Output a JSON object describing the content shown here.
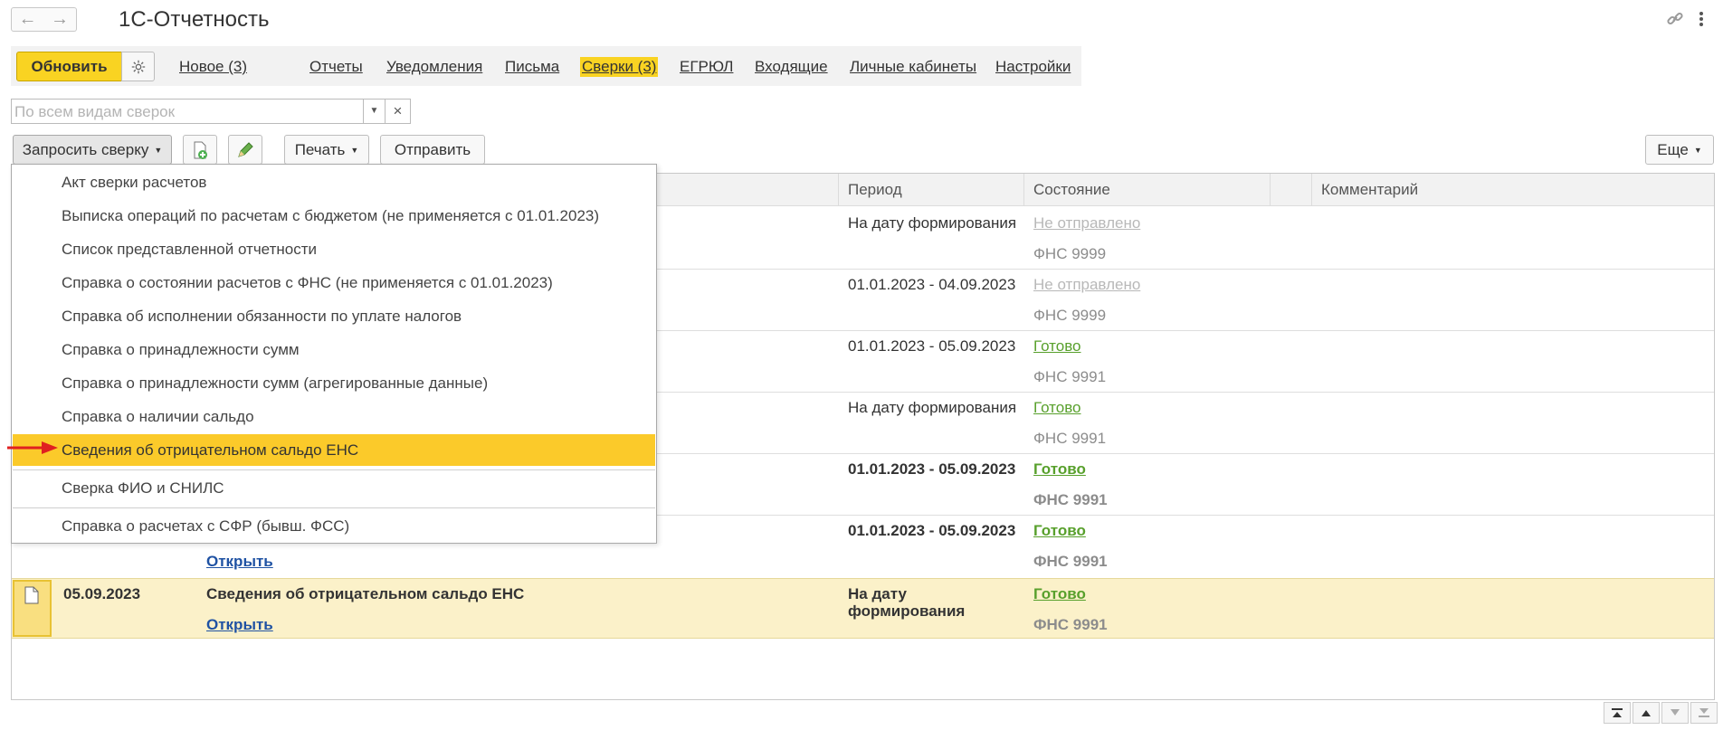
{
  "window": {
    "title": "1С-Отчетность"
  },
  "menu": {
    "refresh": "Обновить",
    "items": [
      "Новое (3)",
      "Отчеты",
      "Уведомления",
      "Письма",
      "Сверки (3)",
      "ЕГРЮЛ",
      "Входящие",
      "Личные кабинеты",
      "Настройки"
    ]
  },
  "search": {
    "placeholder": "По всем видам сверок"
  },
  "toolbar": {
    "request": "Запросить сверку",
    "print": "Печать",
    "send": "Отправить",
    "more": "Еще"
  },
  "columns": {
    "period": "Период",
    "state": "Состояние",
    "comment": "Комментарий"
  },
  "dropdown": {
    "items": [
      "Акт сверки расчетов",
      "Выписка операций по расчетам с бюджетом (не применяется с 01.01.2023)",
      "Список представленной отчетности",
      "Справка о состоянии расчетов с ФНС (не применяется с 01.01.2023)",
      "Справка об исполнении обязанности по уплате налогов",
      "Справка о принадлежности сумм",
      "Справка о принадлежности сумм (агрегированные данные)",
      "Справка о наличии сальдо",
      "Сведения об отрицательном сальдо ЕНС",
      "Сверка ФИО и СНИЛС",
      "Справка о расчетах с СФР (бывш. ФСС)"
    ],
    "highlighted_index": 8
  },
  "rows": [
    {
      "period": "На дату формирования",
      "status": "Не отправлено",
      "authority": "ФНС 9999"
    },
    {
      "period": "01.01.2023 - 04.09.2023",
      "status": "Не отправлено",
      "authority": "ФНС 9999"
    },
    {
      "period": "01.01.2023 - 05.09.2023",
      "status": "Готово",
      "authority": "ФНС 9991"
    },
    {
      "period": "На дату формирования",
      "status": "Готово",
      "authority": "ФНС 9991"
    },
    {
      "period": "01.01.2023 - 05.09.2023",
      "status": "Готово",
      "authority": "ФНС 9991"
    },
    {
      "period": "01.01.2023 - 05.09.2023",
      "status": "Готово",
      "authority": "ФНС 9991",
      "link": "Открыть"
    }
  ],
  "selected_row": {
    "date": "05.09.2023",
    "name": "Сведения об отрицательном сальдо ЕНС",
    "link": "Открыть",
    "period_line1": "На дату",
    "period_line2": "формирования",
    "status": "Готово",
    "authority": "ФНС 9991"
  },
  "colors": {
    "accent": "#f9d322",
    "highlight": "#fbca2a",
    "ready": "#58a02c",
    "link": "#1f52a3",
    "selected_row": "#fbf1c9"
  }
}
